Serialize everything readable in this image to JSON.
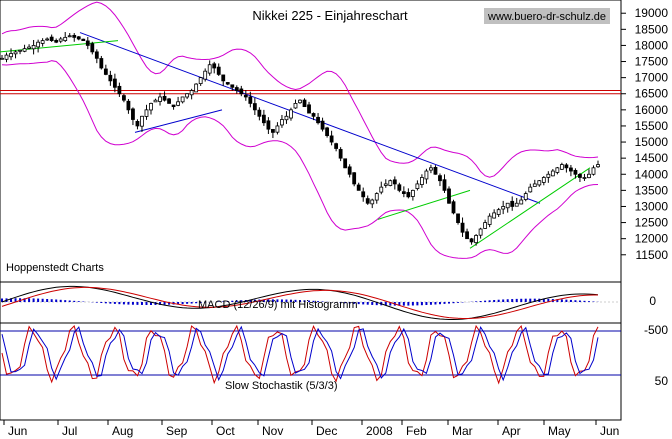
{
  "chart_data": {
    "type": "candlestick",
    "title": "Nikkei 225 - Einjahreschart",
    "watermark": "www.buero-dr-schulz.de",
    "source_label": "Hoppenstedt Charts",
    "months": [
      "Jun",
      "Jul",
      "Aug",
      "Sep",
      "Oct",
      "Nov",
      "Dec",
      "2008",
      "Feb",
      "Mar",
      "Apr",
      "May",
      "Jun"
    ],
    "price_axis": {
      "ticks": [
        "19000",
        "18500",
        "18000",
        "17500",
        "17000",
        "16500",
        "16000",
        "15500",
        "15000",
        "14500",
        "14000",
        "13500",
        "13000",
        "12500",
        "12000",
        "11500"
      ],
      "ylim": [
        11400,
        19100
      ]
    },
    "close": [
      17600,
      17700,
      17750,
      17800,
      17850,
      17900,
      17950,
      18000,
      18100,
      18150,
      18200,
      18150,
      18100,
      18200,
      18250,
      18300,
      18250,
      18200,
      18150,
      18000,
      17800,
      17600,
      17300,
      17100,
      16900,
      16700,
      16500,
      16300,
      16000,
      15700,
      15500,
      15800,
      16000,
      16200,
      16300,
      16400,
      16300,
      16200,
      16100,
      16250,
      16400,
      16500,
      16600,
      16800,
      17000,
      17200,
      17400,
      17300,
      17100,
      16900,
      16800,
      16700,
      16600,
      16500,
      16400,
      16200,
      16000,
      15800,
      15600,
      15400,
      15300,
      15500,
      15700,
      15800,
      16000,
      16200,
      16300,
      16100,
      15900,
      15800,
      15600,
      15400,
      15200,
      15000,
      14800,
      14500,
      14200,
      14000,
      13700,
      13500,
      13300,
      13100,
      13200,
      13400,
      13600,
      13700,
      13800,
      13700,
      13500,
      13400,
      13300,
      13500,
      13700,
      13900,
      14100,
      14200,
      14000,
      13800,
      13500,
      13100,
      12800,
      12500,
      12200,
      12000,
      11900,
      12100,
      12300,
      12500,
      12700,
      12800,
      12900,
      13000,
      13100,
      13000,
      13100,
      13200,
      13400,
      13600,
      13700,
      13800,
      13900,
      14000,
      14100,
      14200,
      14300,
      14200,
      14100,
      14000,
      13900,
      13900,
      14000,
      14200,
      14300
    ],
    "indicators": [
      {
        "name": "MACD (12/26/9) mit Histogramm",
        "axis": [
          "0",
          "-500"
        ]
      },
      {
        "name": "Slow Stochastik (5/3/3)",
        "axis": [
          "50"
        ]
      }
    ],
    "horizontal_lines": [
      16600,
      16500
    ],
    "colors": {
      "candles": "#000000",
      "bands": "#d000d0",
      "trend": "#0000cc",
      "trend_green": "#00cc00",
      "resistance": "#cc0000",
      "macd_blue": "#0000cc",
      "macd_red": "#cc0000"
    },
    "grid": false
  }
}
